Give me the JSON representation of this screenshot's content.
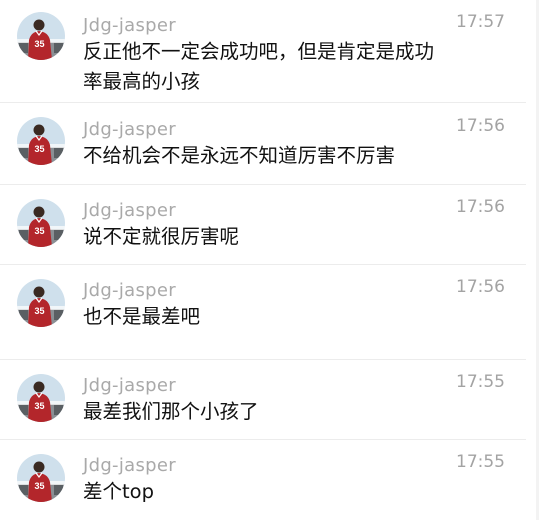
{
  "messages": [
    {
      "name": "Jdg-jasper",
      "time": "17:57",
      "text": "反正他不一定会成功吧，但是肯定是成功率最高的小孩"
    },
    {
      "name": "Jdg-jasper",
      "time": "17:56",
      "text": "不给机会不是永远不知道厉害不厉害"
    },
    {
      "name": "Jdg-jasper",
      "time": "17:56",
      "text": "说不定就很厉害呢"
    },
    {
      "name": "Jdg-jasper",
      "time": "17:56",
      "text": "也不是最差吧"
    },
    {
      "name": "Jdg-jasper",
      "time": "17:55",
      "text": "最差我们那个小孩了"
    },
    {
      "name": "Jdg-jasper",
      "time": "17:55",
      "text": "差个top"
    }
  ],
  "avatar": {
    "icon": "player-avatar-icon",
    "jersey_number": "35",
    "colors": {
      "jersey": "#b3262b",
      "sky": "#cfe0ec",
      "ground": "#8a8f94"
    }
  }
}
